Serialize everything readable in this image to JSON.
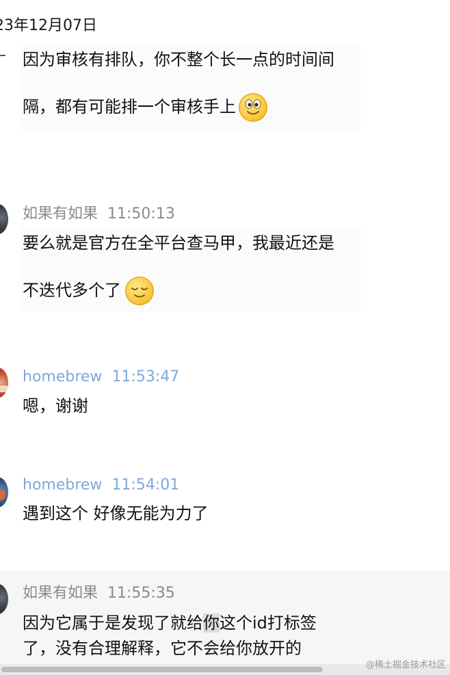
{
  "chat": {
    "date_header": "23年12月07日",
    "messages": [
      {
        "lines": [
          "因为审核有排队，你不整个长一点的时间间",
          "隔，都有可能排一个审核手上"
        ],
        "emoji": "grinning-face-emoji"
      },
      {
        "sender": "如果有如果",
        "time": "11:50:13",
        "lines": [
          "要么就是官方在全平台查马甲，我最近还是",
          "不迭代多个了"
        ],
        "emoji": "relieved-face-emoji"
      },
      {
        "sender": "homebrew",
        "time": "11:53:47",
        "lines": [
          "嗯，谢谢"
        ]
      },
      {
        "sender": "homebrew",
        "time": "11:54:01",
        "lines": [
          "遇到这个 好像无能为力了"
        ]
      },
      {
        "sender": "如果有如果",
        "time": "11:55:35",
        "line1_before": "因为它属于是发现了就给",
        "line1_selected": "你",
        "line1_after": "这个id打标签",
        "line2": "了，没有合理解释，它不会给你放开的"
      }
    ]
  },
  "watermark": "@稀土掘金技术社区",
  "colors": {
    "sender_gray": "#8a8a8a",
    "sender_blue": "#7fa8d9",
    "text": "#111111"
  }
}
